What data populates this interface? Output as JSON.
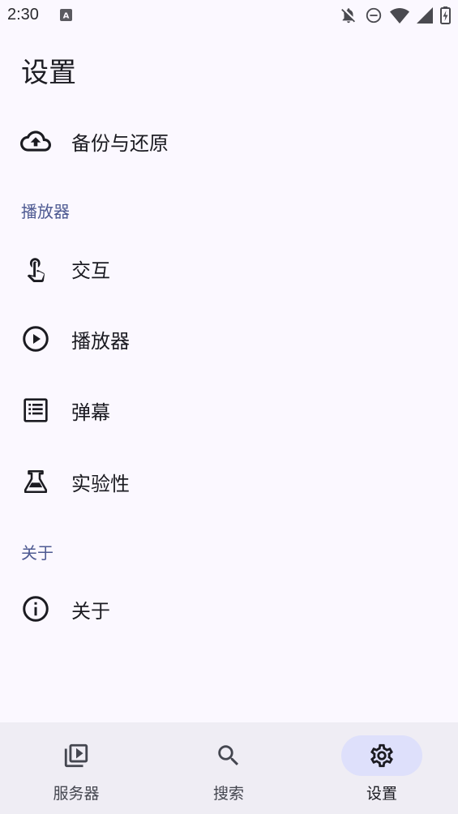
{
  "status_bar": {
    "time": "2:30",
    "icons": [
      "notification-a-icon",
      "bell-off-icon",
      "do-not-disturb-icon",
      "wifi-icon",
      "cellular-signal-icon",
      "battery-charging-icon"
    ]
  },
  "page": {
    "title": "设置"
  },
  "items_top": [
    {
      "label": "备份与还原",
      "icon": "cloud-upload-icon"
    }
  ],
  "sections": {
    "player": {
      "header": "播放器",
      "items": [
        {
          "label": "交互",
          "icon": "touch-icon"
        },
        {
          "label": "播放器",
          "icon": "play-circle-icon"
        },
        {
          "label": "弹幕",
          "icon": "danmaku-icon"
        },
        {
          "label": "实验性",
          "icon": "flask-icon"
        }
      ]
    },
    "about": {
      "header": "关于",
      "items": [
        {
          "label": "关于",
          "icon": "info-icon"
        }
      ]
    }
  },
  "bottom_nav": {
    "items": [
      {
        "label": "服务器",
        "icon": "video-library-icon",
        "active": false
      },
      {
        "label": "搜索",
        "icon": "search-icon",
        "active": false
      },
      {
        "label": "设置",
        "icon": "gear-icon",
        "active": true
      }
    ]
  },
  "colors": {
    "background": "#fbf8ff",
    "section_header": "#4e5a92",
    "nav_background": "#efedf4",
    "nav_active_pill": "#dee0fb"
  }
}
